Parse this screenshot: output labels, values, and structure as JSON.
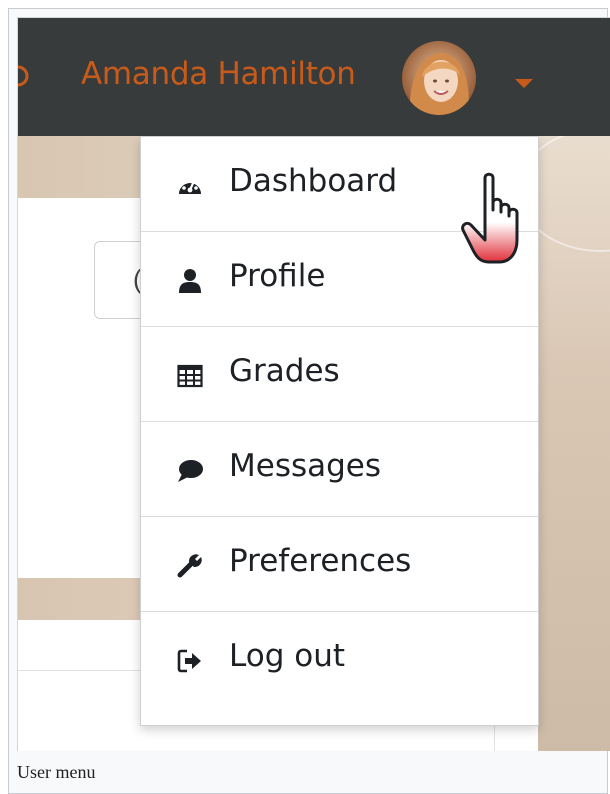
{
  "navbar": {
    "user_name": "Amanda Hamilton",
    "avatar_icon": "user-avatar-photo",
    "caret_icon": "caret-down-icon",
    "accent_color": "#c95b1a",
    "bar_color": "#383b3c"
  },
  "background": {
    "partial_button_text": "("
  },
  "user_menu": {
    "items": [
      {
        "label": "Dashboard",
        "icon": "tachometer-icon"
      },
      {
        "label": "Profile",
        "icon": "user-icon"
      },
      {
        "label": "Grades",
        "icon": "table-icon"
      },
      {
        "label": "Messages",
        "icon": "comment-icon"
      },
      {
        "label": "Preferences",
        "icon": "wrench-icon"
      },
      {
        "label": "Log out",
        "icon": "sign-out-icon"
      }
    ]
  },
  "pointer": {
    "icon": "hand-pointer-icon"
  },
  "caption": "User menu"
}
